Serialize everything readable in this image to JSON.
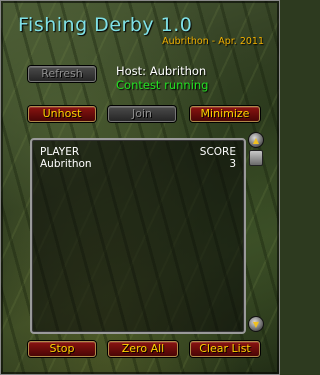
{
  "window": {
    "title": "Fishing Derby 1.0",
    "subtitle": "Aubrithon - Apr. 2011"
  },
  "controls": {
    "refresh_label": "Refresh",
    "host_label": "Host: Aubrithon",
    "status_text": "Contest running",
    "unhost_label": "Unhost",
    "join_label": "Join",
    "minimize_label": "Minimize"
  },
  "scoreboard": {
    "columns": [
      "PLAYER",
      "SCORE"
    ],
    "rows": [
      {
        "player": "Aubrithon",
        "score": "3"
      }
    ]
  },
  "footer": {
    "stop_label": "Stop",
    "zero_all_label": "Zero All",
    "clear_list_label": "Clear List"
  },
  "icons": {
    "scroll_up": "scroll-up-icon",
    "scroll_down": "scroll-down-icon"
  },
  "colors": {
    "title": "#7fe0e6",
    "subtitle": "#f0b000",
    "status": "#22e022",
    "button_text": "#ffd200"
  }
}
